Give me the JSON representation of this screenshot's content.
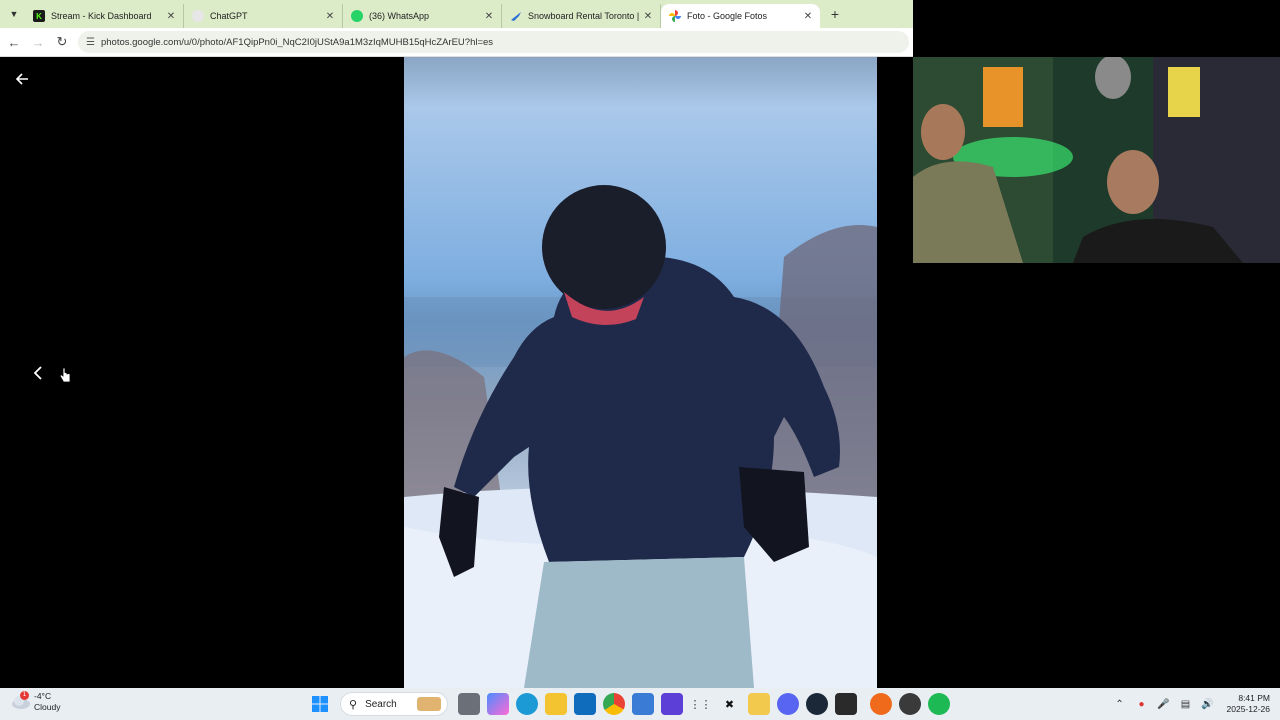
{
  "browser": {
    "tabs": [
      {
        "title": "Stream - Kick Dashboard",
        "icon": "kick-icon",
        "color": "#53fc18",
        "glyph": "K"
      },
      {
        "title": "ChatGPT",
        "icon": "chatgpt-icon",
        "color": "#e6e6e6",
        "glyph": ""
      },
      {
        "title": "(36) WhatsApp",
        "icon": "whatsapp-icon",
        "color": "#25d366",
        "glyph": ""
      },
      {
        "title": "Snowboard Rental Toronto | Re",
        "icon": "snowboard-icon",
        "color": "#2a6fd6",
        "glyph": ""
      },
      {
        "title": "Foto - Google Fotos",
        "icon": "google-photos-icon",
        "color": "#ea4335",
        "glyph": ""
      }
    ],
    "url": "photos.google.com/u/0/photo/AF1QipPn0i_NqC2I0jUStA9a1M3zIqMUHB15qHcZArEU?hl=es"
  },
  "viewer": {
    "back_icon": "arrow-left-icon",
    "prev_icon": "chevron-left-icon"
  },
  "taskbar": {
    "weather_temp": "-4°C",
    "weather_desc": "Cloudy",
    "weather_alert": "1",
    "search_label": "Search",
    "time": "8:41 PM",
    "date": "2025-12-26"
  }
}
